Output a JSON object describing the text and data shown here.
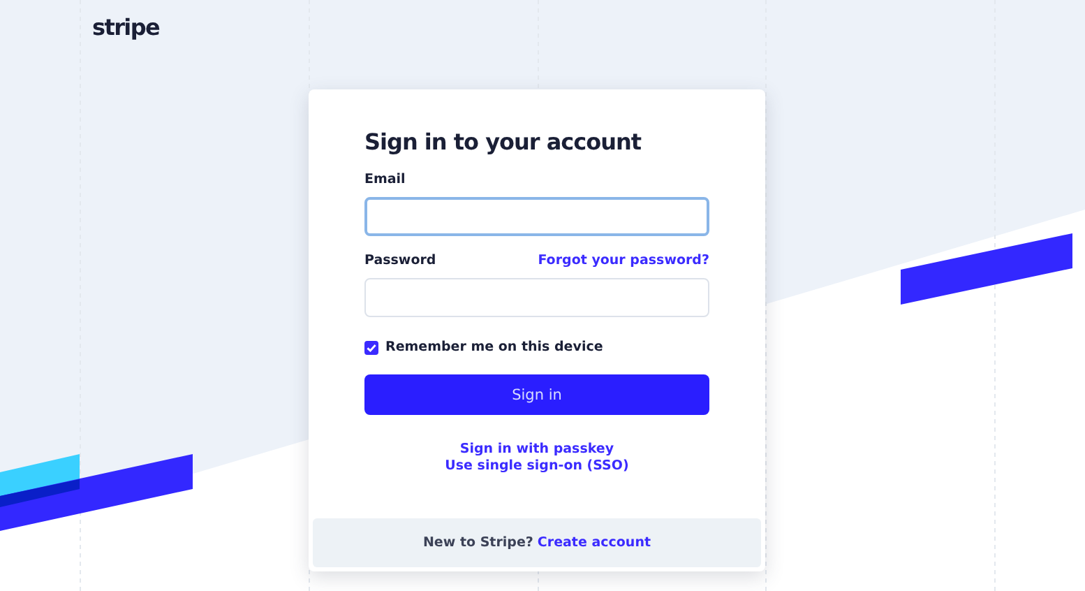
{
  "logo": "stripe",
  "title": "Sign in to your account",
  "fields": [
    {
      "label": "Email",
      "focused": true
    },
    {
      "label": "Password",
      "focused": false,
      "link": "Forgot your password?"
    }
  ],
  "remember": {
    "label": "Remember me on this device",
    "checked": true
  },
  "submit": "Sign in",
  "alt_links": [
    "Sign in with passkey",
    "Use single sign-on (SSO)"
  ],
  "footer": {
    "prompt": "New to Stripe?",
    "link": "Create account"
  }
}
